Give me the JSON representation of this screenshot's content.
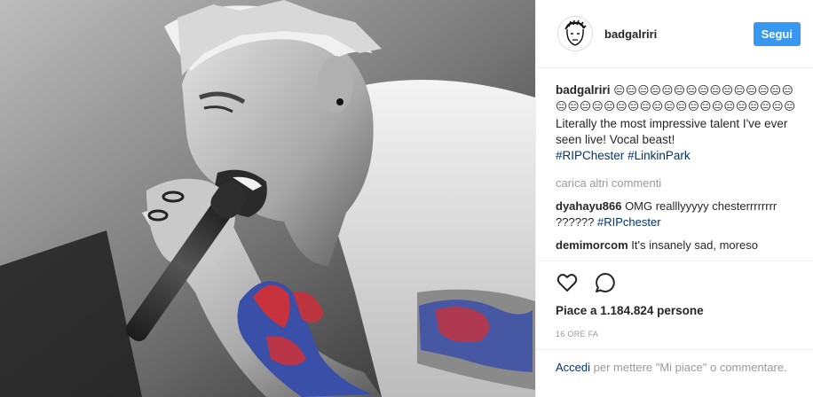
{
  "header": {
    "username": "badgalriri",
    "follow_label": "Segui"
  },
  "caption": {
    "username": "badgalriri",
    "emojis": "😑😑😑😑😑😑😑😑😑😑😑😑😑😑😑😑😑😑😑😑😑😑😑😑😑😑😑😑😑😑😑😑😑😑😑",
    "text": "Literally the most impressive talent I've ever seen live! Vocal beast!",
    "hashtags": [
      "#RIPChester",
      "#LinkinPark"
    ]
  },
  "load_more_label": "carica altri commenti",
  "comments": [
    {
      "username": "dyahayu866",
      "text": "OMG realllyyyyy chesterrrrrrrr ??????",
      "hashtag": "#RIPchester"
    },
    {
      "username": "demimorcom",
      "text": "It's insanely sad, moreso"
    }
  ],
  "actions": {
    "like_icon": "heart-icon",
    "comment_icon": "speech-bubble-icon",
    "likes_text": "Piace a 1.184.824 persone",
    "timestamp": "16 ORE FA"
  },
  "login_prompt": {
    "link": "Accedi",
    "text": "per mettere \"Mi piace\" o commentare."
  },
  "photo": {
    "subject": "black-and-white photo of singer shouting into microphone with colour flame tattoo on forearm"
  },
  "colors": {
    "accent": "#3897f0",
    "hashtag": "#003569",
    "muted": "#999999",
    "tattoo_red": "#c8323c",
    "tattoo_blue": "#3a4fa8"
  }
}
